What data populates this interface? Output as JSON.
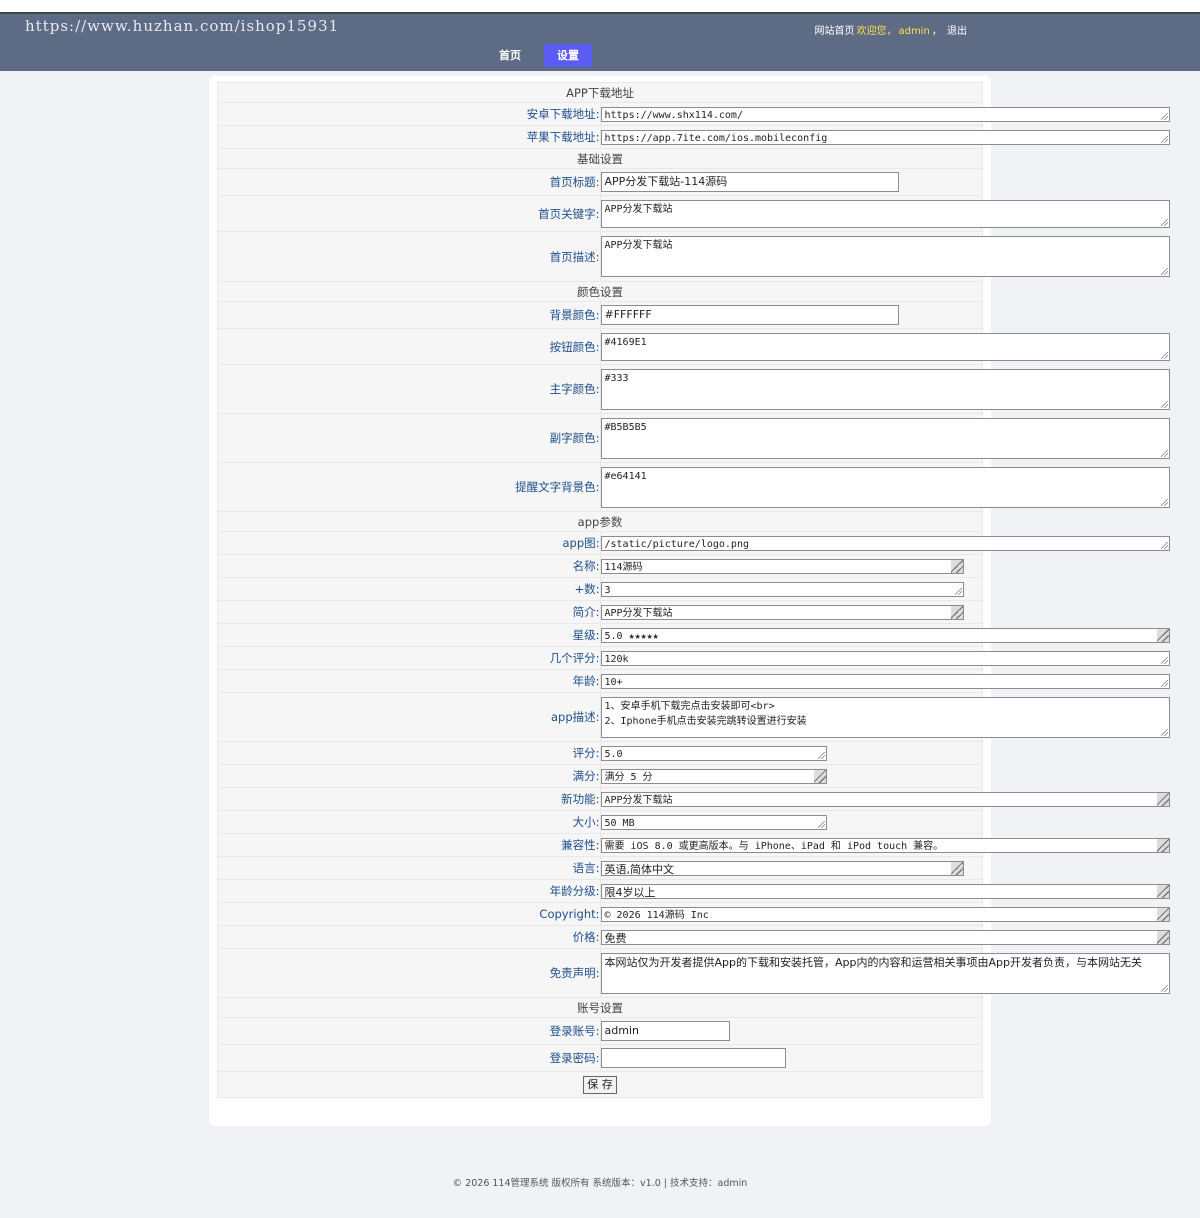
{
  "watermark": "https://www.huzhan.com/ishop15931",
  "userbar": {
    "home": "网站首页",
    "welcome": "欢迎您，",
    "user": "admin",
    "sep": "，",
    "logout": "退出"
  },
  "nav": {
    "home": "首页",
    "settings": "设置"
  },
  "sections": {
    "app_download": "APP下载地址",
    "basic": "基础设置",
    "color": "颜色设置",
    "app_params": "app参数",
    "account": "账号设置"
  },
  "fields": {
    "android_url": {
      "label": "安卓下载地址:",
      "value": "https://www.shx114.com/"
    },
    "ios_url": {
      "label": "苹果下载地址:",
      "value": "https://app.7ite.com/ios.mobileconfig"
    },
    "home_title": {
      "label": "首页标题:",
      "value": "APP分发下载站-114源码"
    },
    "home_keywords": {
      "label": "首页关键字:",
      "value": "APP分发下载站"
    },
    "home_desc": {
      "label": "首页描述:",
      "value": "APP分发下载站"
    },
    "bg_color": {
      "label": "背景颜色:",
      "value": "#FFFFFF"
    },
    "btn_color": {
      "label": "按钮颜色:",
      "value": "#4169E1"
    },
    "main_text_color": {
      "label": "主字颜色:",
      "value": "#333"
    },
    "sub_text_color": {
      "label": "副字颜色:",
      "value": "#B5B5B5"
    },
    "alert_bg_color": {
      "label": "提醒文字背景色:",
      "value": "#e64141"
    },
    "app_icon": {
      "label": "app图:",
      "value": "/static/picture/logo.png"
    },
    "name": {
      "label": "名称:",
      "value": "114源码"
    },
    "plus_count": {
      "label": "+数:",
      "value": "3"
    },
    "intro": {
      "label": "简介:",
      "value": "APP分发下载站"
    },
    "stars": {
      "label": "星级:",
      "value": "5.0 ★★★★★"
    },
    "ratings_count": {
      "label": "几个评分:",
      "value": "120k"
    },
    "age": {
      "label": "年龄:",
      "value": "10+"
    },
    "app_desc": {
      "label": "app描述:",
      "value": "1、安卓手机下载完点击安装即可<br>\n2、Iphone手机点击安装完跳转设置进行安装"
    },
    "score": {
      "label": "评分:",
      "value": "5.0"
    },
    "full_score": {
      "label": "满分:",
      "value": "满分 5 分"
    },
    "new_features": {
      "label": "新功能:",
      "value": "APP分发下载站"
    },
    "size": {
      "label": "大小:",
      "value": "50 MB"
    },
    "compat": {
      "label": "兼容性:",
      "value": "需要 iOS 8.0 或更高版本。与 iPhone、iPad 和 iPod touch 兼容。"
    },
    "language": {
      "label": "语言:",
      "value": "英语,简体中文"
    },
    "age_rating": {
      "label": "年龄分级:",
      "value": "限4岁以上"
    },
    "copyright": {
      "label": "Copyright:",
      "value": "© 2026 114源码 Inc"
    },
    "price": {
      "label": "价格:",
      "value": "免费"
    },
    "disclaimer": {
      "label": "免责声明:",
      "value": "本网站仅为开发者提供App的下载和安装托管，App内的内容和运营相关事项由App开发者负责，与本网站无关"
    },
    "login_account": {
      "label": "登录账号:",
      "value": "admin"
    },
    "login_password": {
      "label": "登录密码:",
      "value": ""
    }
  },
  "save_label": "保 存",
  "footer": "© 2026 114管理系统 版权所有 系统版本：v1.0 | 技术支持：admin"
}
